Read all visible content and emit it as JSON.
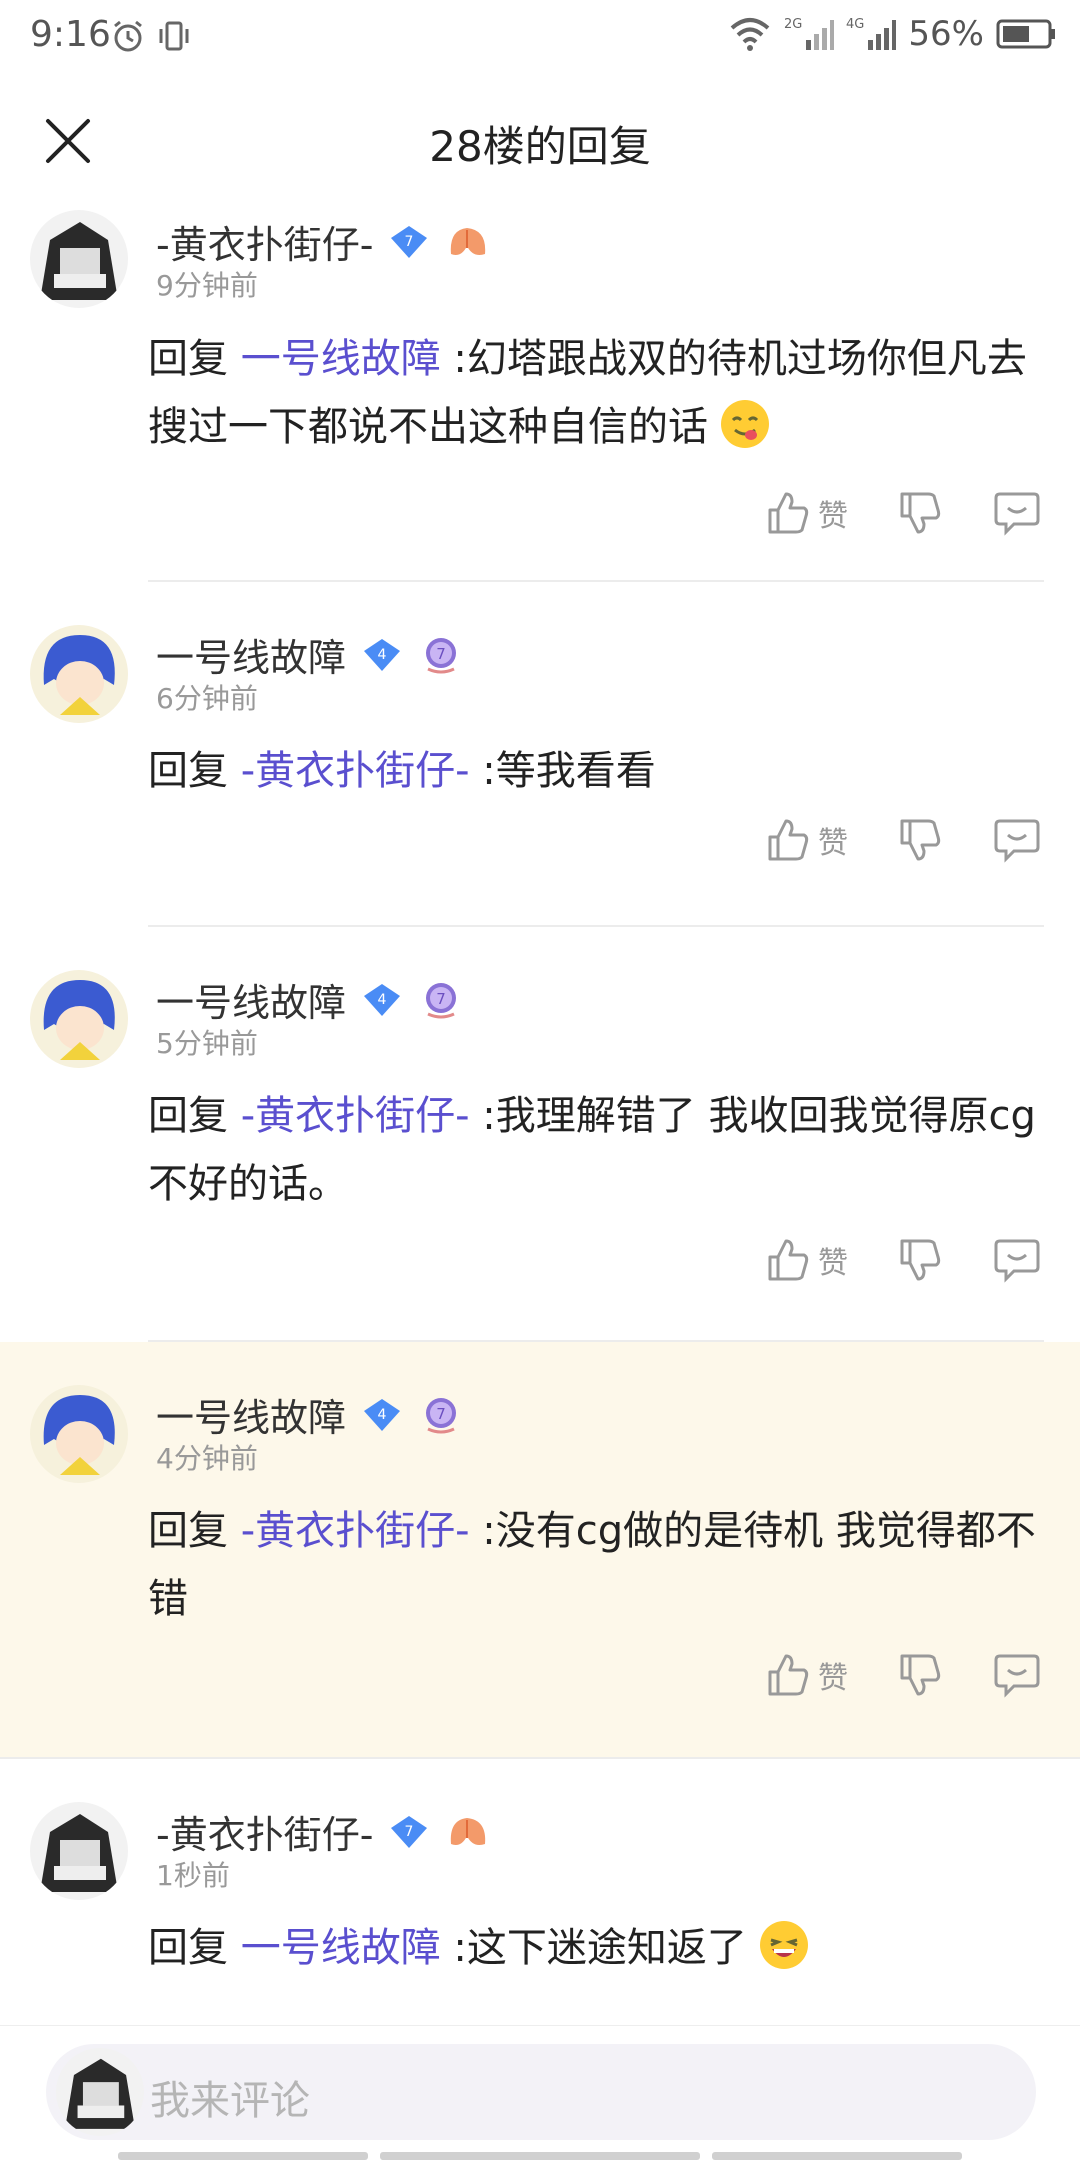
{
  "status_bar": {
    "time": "9:16",
    "battery_percent": "56%",
    "network_labels": [
      "2G",
      "4G"
    ]
  },
  "header": {
    "title": "28楼的回复",
    "close_icon": "close-icon"
  },
  "colors": {
    "mention": "#5a4fcf",
    "highlight_bg": "#fdf8ea",
    "badge_blue": "#4a8cf5"
  },
  "comments": [
    {
      "username": "-黄衣扑街仔-",
      "level": "7",
      "time": "9分钟前",
      "reply_prefix": "回复 ",
      "mention": "一号线故障",
      "text": " :幻塔跟战双的待机过场你但凡去搜过一下都说不出这种自信的话",
      "emoji": "yum-emoji",
      "like_label": "赞"
    },
    {
      "username": "一号线故障",
      "level": "4",
      "badge2": "7",
      "time": "6分钟前",
      "reply_prefix": "回复 ",
      "mention": "-黄衣扑街仔-",
      "text": " :等我看看",
      "like_label": "赞"
    },
    {
      "username": "一号线故障",
      "level": "4",
      "badge2": "7",
      "time": "5分钟前",
      "reply_prefix": "回复 ",
      "mention": "-黄衣扑街仔-",
      "text": " :我理解错了 我收回我觉得原cg不好的话。",
      "like_label": "赞"
    },
    {
      "username": "一号线故障",
      "level": "4",
      "badge2": "7",
      "time": "4分钟前",
      "reply_prefix": "回复 ",
      "mention": "-黄衣扑街仔-",
      "text": " :没有cg做的是待机 我觉得都不错",
      "like_label": "赞"
    },
    {
      "username": "-黄衣扑街仔-",
      "level": "7",
      "time": "1秒前",
      "reply_prefix": "回复 ",
      "mention": "一号线故障",
      "text": " :这下迷途知返了",
      "emoji": "grin-emoji",
      "like_label": "赞"
    }
  ],
  "bottom": {
    "placeholder": "我来评论"
  }
}
